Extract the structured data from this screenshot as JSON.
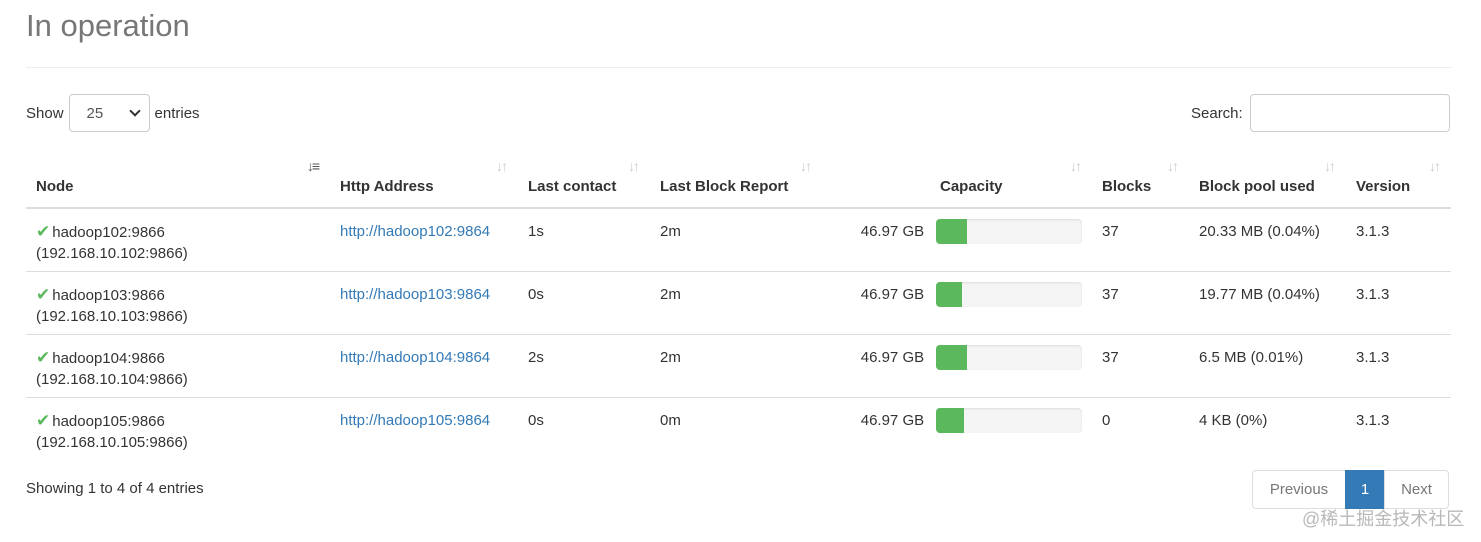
{
  "page": {
    "title": "In operation"
  },
  "length": {
    "show_label": "Show",
    "value": "25",
    "entries_label": "entries"
  },
  "search": {
    "label": "Search:",
    "value": "",
    "placeholder": ""
  },
  "table": {
    "headers": [
      {
        "label": "Node",
        "sort_icon": "sort-amount-asc-icon"
      },
      {
        "label": "Http Address",
        "sort_icon": "sort-both-icon"
      },
      {
        "label": "Last contact",
        "sort_icon": "sort-both-icon"
      },
      {
        "label": "Last Block Report",
        "sort_icon": "sort-both-icon"
      },
      {
        "label": "Capacity",
        "sort_icon": "sort-both-icon"
      },
      {
        "label": "Blocks",
        "sort_icon": "sort-both-icon"
      },
      {
        "label": "Block pool used",
        "sort_icon": "sort-both-icon"
      },
      {
        "label": "Version",
        "sort_icon": "sort-both-icon"
      }
    ],
    "rows": [
      {
        "node": "hadoop102:9866",
        "ip": "(192.168.10.102:9866)",
        "http": "http://hadoop102:9864",
        "last_contact": "1s",
        "last_block_report": "2m",
        "capacity": "46.97 GB",
        "capacity_used_pct": 21,
        "blocks": "37",
        "block_pool_used": "20.33 MB (0.04%)",
        "version": "3.1.3"
      },
      {
        "node": "hadoop103:9866",
        "ip": "(192.168.10.103:9866)",
        "http": "http://hadoop103:9864",
        "last_contact": "0s",
        "last_block_report": "2m",
        "capacity": "46.97 GB",
        "capacity_used_pct": 18,
        "blocks": "37",
        "block_pool_used": "19.77 MB (0.04%)",
        "version": "3.1.3"
      },
      {
        "node": "hadoop104:9866",
        "ip": "(192.168.10.104:9866)",
        "http": "http://hadoop104:9864",
        "last_contact": "2s",
        "last_block_report": "2m",
        "capacity": "46.97 GB",
        "capacity_used_pct": 21,
        "blocks": "37",
        "block_pool_used": "6.5 MB (0.01%)",
        "version": "3.1.3"
      },
      {
        "node": "hadoop105:9866",
        "ip": "(192.168.10.105:9866)",
        "http": "http://hadoop105:9864",
        "last_contact": "0s",
        "last_block_report": "0m",
        "capacity": "46.97 GB",
        "capacity_used_pct": 19,
        "blocks": "0",
        "block_pool_used": "4 KB (0%)",
        "version": "3.1.3"
      }
    ]
  },
  "footer": {
    "info": "Showing 1 to 4 of 4 entries",
    "pagination": {
      "previous": "Previous",
      "current": "1",
      "next": "Next"
    }
  },
  "watermark": "@稀土掘金技术社区",
  "colors": {
    "accent": "#337ab7",
    "success": "#5cb85c",
    "muted": "#777777"
  }
}
